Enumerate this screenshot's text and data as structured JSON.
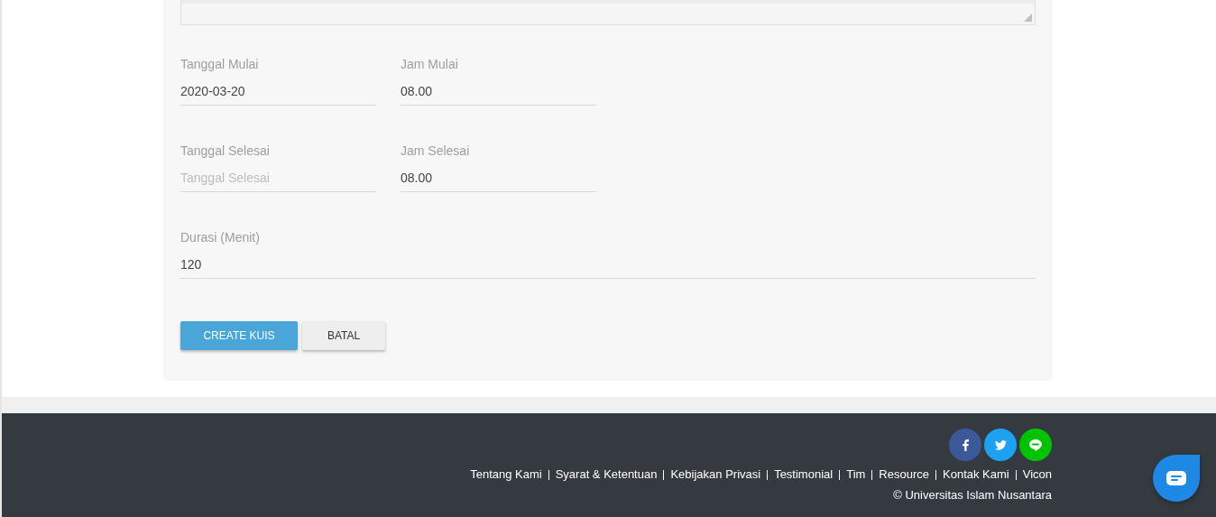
{
  "form": {
    "rows": [
      [
        {
          "label": "Tanggal Mulai",
          "value": "2020-03-20"
        },
        {
          "label": "Jam Mulai",
          "value": "08.00"
        }
      ],
      [
        {
          "label": "Tanggal Selesai",
          "placeholder": "Tanggal Selesai"
        },
        {
          "label": "Jam Selesai",
          "value": "08.00"
        }
      ]
    ],
    "duration": {
      "label": "Durasi (Menit)",
      "value": "120"
    },
    "buttons": [
      {
        "label": "CREATE KUIS",
        "kind": "primary"
      },
      {
        "label": "BATAL",
        "kind": "secondary"
      }
    ]
  },
  "footer": {
    "links": [
      "Tentang Kami",
      "Syarat & Ketentuan",
      "Kebijakan Privasi",
      "Testimonial",
      "Tim",
      "Resource",
      "Kontak Kami",
      "Vicon"
    ],
    "copyright": "© Universitas Islam Nusantara"
  }
}
